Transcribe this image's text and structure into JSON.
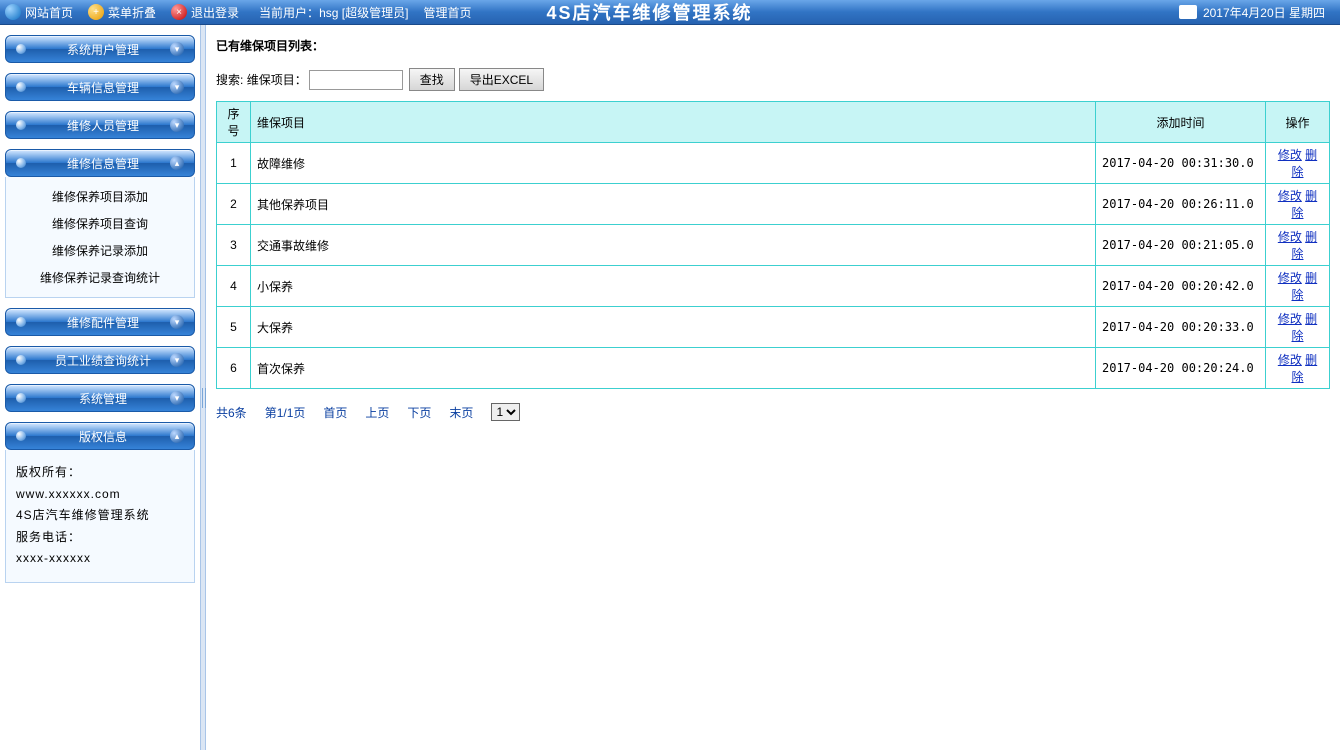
{
  "topbar": {
    "home": "网站首页",
    "fold": "菜单折叠",
    "logout": "退出登录",
    "current_user_prefix": "当前用户：",
    "current_user": "hsg",
    "role": "[超级管理员]",
    "admin_home": "管理首页",
    "title": "4S店汽车维修管理系统",
    "date": "2017年4月20日 星期四"
  },
  "sidebar": {
    "groups": [
      {
        "label": "系统用户管理",
        "expanded": false
      },
      {
        "label": "车辆信息管理",
        "expanded": false
      },
      {
        "label": "维修人员管理",
        "expanded": false
      },
      {
        "label": "维修信息管理",
        "expanded": true
      },
      {
        "label": "维修配件管理",
        "expanded": false
      },
      {
        "label": "员工业绩查询统计",
        "expanded": false
      },
      {
        "label": "系统管理",
        "expanded": false
      },
      {
        "label": "版权信息",
        "expanded": true
      }
    ],
    "repair_subitems": [
      "维修保养项目添加",
      "维修保养项目查询",
      "维修保养记录添加",
      "维修保养记录查询统计"
    ],
    "copyright": {
      "owner_label": "版权所有：",
      "site": "www.xxxxxx.com",
      "product": "4S店汽车维修管理系统",
      "phone_label": "服务电话：",
      "phone": "xxxx-xxxxxx"
    }
  },
  "content": {
    "list_title": "已有维保项目列表：",
    "search_label": "搜索:",
    "field_label": "维保项目：",
    "search_value": "",
    "btn_search": "查找",
    "btn_export": "导出EXCEL",
    "columns": {
      "idx": "序号",
      "name": "维保项目",
      "time": "添加时间",
      "ops": "操作"
    },
    "rows": [
      {
        "idx": 1,
        "name": "故障维修",
        "time": "2017-04-20 00:31:30.0"
      },
      {
        "idx": 2,
        "name": "其他保养项目",
        "time": "2017-04-20 00:26:11.0"
      },
      {
        "idx": 3,
        "name": "交通事故维修",
        "time": "2017-04-20 00:21:05.0"
      },
      {
        "idx": 4,
        "name": "小保养",
        "time": "2017-04-20 00:20:42.0"
      },
      {
        "idx": 5,
        "name": "大保养",
        "time": "2017-04-20 00:20:33.0"
      },
      {
        "idx": 6,
        "name": "首次保养",
        "time": "2017-04-20 00:20:24.0"
      }
    ],
    "ops": {
      "edit": "修改",
      "del": "删除"
    },
    "pager": {
      "total": "共6条",
      "page": "第1/1页",
      "first": "首页",
      "prev": "上页",
      "next": "下页",
      "last": "末页",
      "jump_options": [
        "1"
      ],
      "jump_selected": "1"
    }
  }
}
